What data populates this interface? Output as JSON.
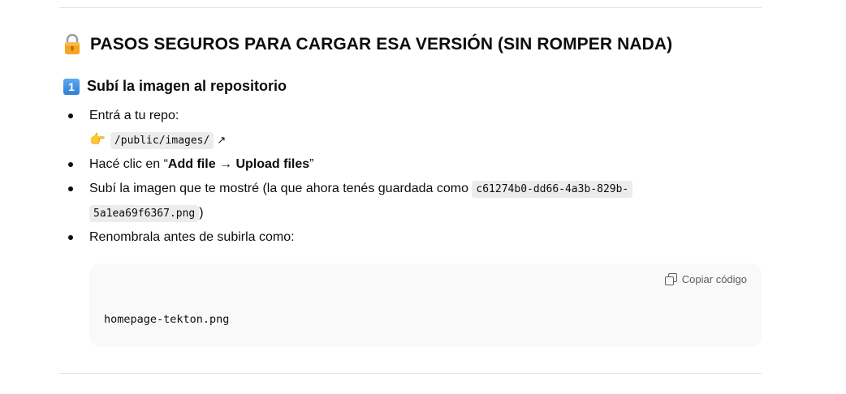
{
  "section": {
    "icon": "lock-icon",
    "title": "PASOS SEGUROS PARA CARGAR ESA VERSIÓN (SIN ROMPER NADA)"
  },
  "step1": {
    "icon": "keycap-one-icon",
    "number": "1",
    "title": "Subí la imagen al repositorio"
  },
  "list": {
    "item1_text": "Entrá a tu repo:",
    "item1_point_icon": "👉",
    "item1_path": "/public/images/",
    "item1_link_icon": "↗",
    "item2_prefix": "Hacé clic en “",
    "item2_bold": "Add file → Upload files",
    "item2_suffix": "”",
    "item3_text": "Subí la imagen que te mostré (la que ahora tenés guardada como ",
    "item3_code_a": "c61274b0-dd66-4a3b-829b-",
    "item3_code_b": "5a1ea69f6367.png",
    "item3_end": ")",
    "item4_text": "Renombrala antes de subirla como:"
  },
  "codeblock": {
    "copy_label": "Copiar código",
    "copy_icon": "copy-icon",
    "content": "homepage-tekton.png"
  }
}
